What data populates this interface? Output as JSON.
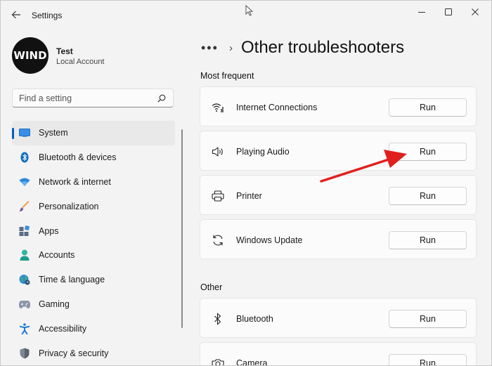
{
  "window": {
    "title": "Settings"
  },
  "user": {
    "avatar_text": "WIND",
    "name": "Test",
    "account_type": "Local Account"
  },
  "search": {
    "placeholder": "Find a setting"
  },
  "sidebar": {
    "items": [
      {
        "label": "System",
        "icon": "system-icon",
        "active": true
      },
      {
        "label": "Bluetooth & devices",
        "icon": "bluetooth-icon"
      },
      {
        "label": "Network & internet",
        "icon": "wifi-icon"
      },
      {
        "label": "Personalization",
        "icon": "brush-icon"
      },
      {
        "label": "Apps",
        "icon": "apps-icon"
      },
      {
        "label": "Accounts",
        "icon": "person-icon"
      },
      {
        "label": "Time & language",
        "icon": "globe-clock-icon"
      },
      {
        "label": "Gaming",
        "icon": "gamepad-icon"
      },
      {
        "label": "Accessibility",
        "icon": "accessibility-icon"
      },
      {
        "label": "Privacy & security",
        "icon": "shield-icon"
      }
    ]
  },
  "main": {
    "more": "•••",
    "separator": "›",
    "title": "Other troubleshooters",
    "sections": [
      {
        "header": "Most frequent",
        "items": [
          {
            "label": "Internet Connections",
            "icon": "wifi-signal-icon",
            "button": "Run"
          },
          {
            "label": "Playing Audio",
            "icon": "speaker-icon",
            "button": "Run"
          },
          {
            "label": "Printer",
            "icon": "printer-icon",
            "button": "Run"
          },
          {
            "label": "Windows Update",
            "icon": "sync-icon",
            "button": "Run"
          }
        ]
      },
      {
        "header": "Other",
        "items": [
          {
            "label": "Bluetooth",
            "icon": "bluetooth-icon",
            "button": "Run"
          },
          {
            "label": "Camera",
            "icon": "camera-icon",
            "button": "Run"
          }
        ]
      }
    ]
  },
  "colors": {
    "accent": "#005fb8",
    "annotation_arrow": "#e0201e"
  }
}
